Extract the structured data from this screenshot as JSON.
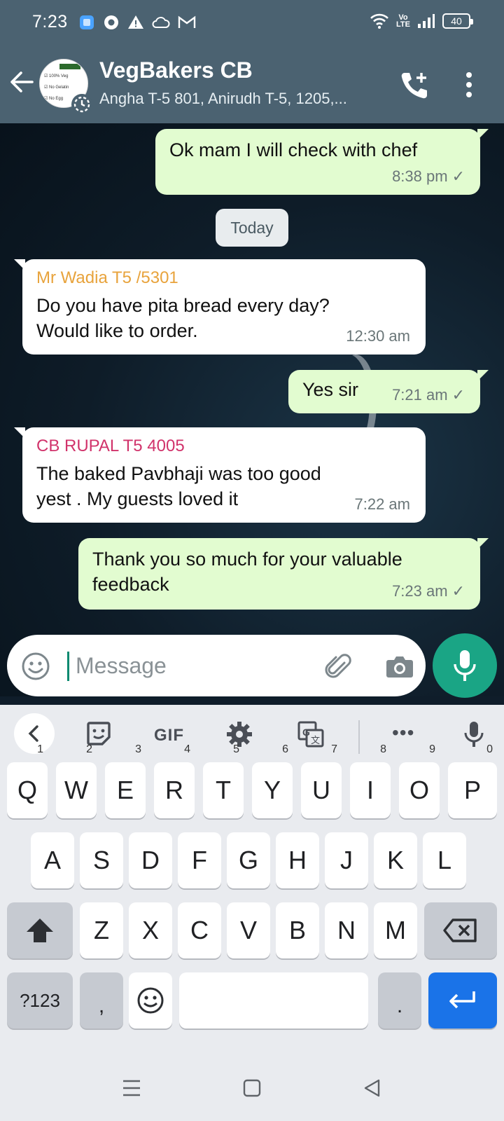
{
  "status_bar": {
    "time": "7:23",
    "battery": "40",
    "network": "Vo\nLTE"
  },
  "header": {
    "title": "VegBakers CB",
    "subtitle": "Angha T-5 801, Anirudh T-5, 1205,...",
    "avatar_lines": [
      "100% Veg",
      "No Gelatin",
      "No Egg"
    ]
  },
  "chat": {
    "date_chip": "Today",
    "messages": [
      {
        "text": "Ok mam I will check with chef",
        "time": "8:38 pm"
      },
      {
        "sender": "Mr Wadia T5 /5301",
        "text_line1": "Do you have pita bread every day?",
        "text_line2": "Would like to order.",
        "time": "12:30 am"
      },
      {
        "text": "Yes sir",
        "time": "7:21 am"
      },
      {
        "sender": "CB RUPAL T5 4005",
        "text_line1": "The baked Pavbhaji was too good",
        "text_line2": "yest . My guests loved it",
        "time": "7:22 am"
      },
      {
        "text_line1": "Thank you so much for your valuable",
        "text_line2": "feedback",
        "time": "7:23 am"
      }
    ],
    "tick": "✓",
    "colors": {
      "sender1": "#e8a33c",
      "sender2": "#d1336b"
    }
  },
  "composer": {
    "placeholder": "Message"
  },
  "keyboard": {
    "toolbar": {
      "gif": "GIF",
      "more": "•••"
    },
    "row1": [
      "Q",
      "W",
      "E",
      "R",
      "T",
      "Y",
      "U",
      "I",
      "O",
      "P"
    ],
    "row1_hints": [
      "1",
      "2",
      "3",
      "4",
      "5",
      "6",
      "7",
      "8",
      "9",
      "0"
    ],
    "row2": [
      "A",
      "S",
      "D",
      "F",
      "G",
      "H",
      "J",
      "K",
      "L"
    ],
    "row3": [
      "Z",
      "X",
      "C",
      "V",
      "B",
      "N",
      "M"
    ],
    "symbols": "?123",
    "comma": ",",
    "period": "."
  }
}
